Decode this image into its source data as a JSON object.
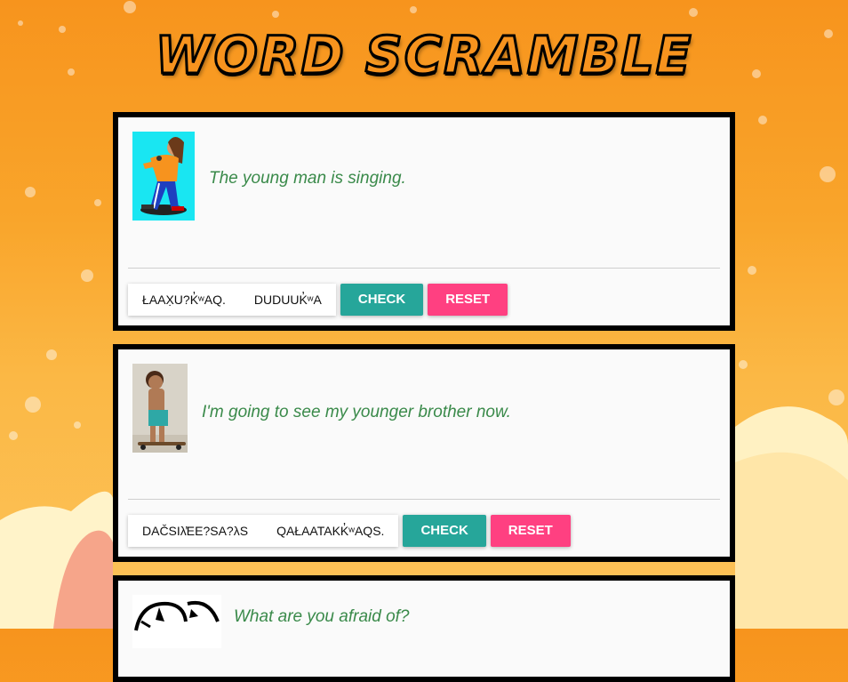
{
  "app": {
    "title": "WORD SCRAMBLE"
  },
  "cards": [
    {
      "sentence": "The young man is singing.",
      "chips": [
        "ŁAAX̣U?K̓ʷAQ.",
        "DUDUUK̓ʷA"
      ],
      "check_label": "CHECK",
      "reset_label": "RESET"
    },
    {
      "sentence": "I'm going to see my younger brother now.",
      "chips": [
        "DAČSIλ̓EE?SA?λS",
        "QAŁAATAKK̓ʷAQS."
      ],
      "check_label": "CHECK",
      "reset_label": "RESET"
    },
    {
      "sentence": "What are you afraid of?"
    }
  ],
  "colors": {
    "check": "#26a69a",
    "reset": "#ff4081",
    "sentence": "#3a8a4a"
  }
}
